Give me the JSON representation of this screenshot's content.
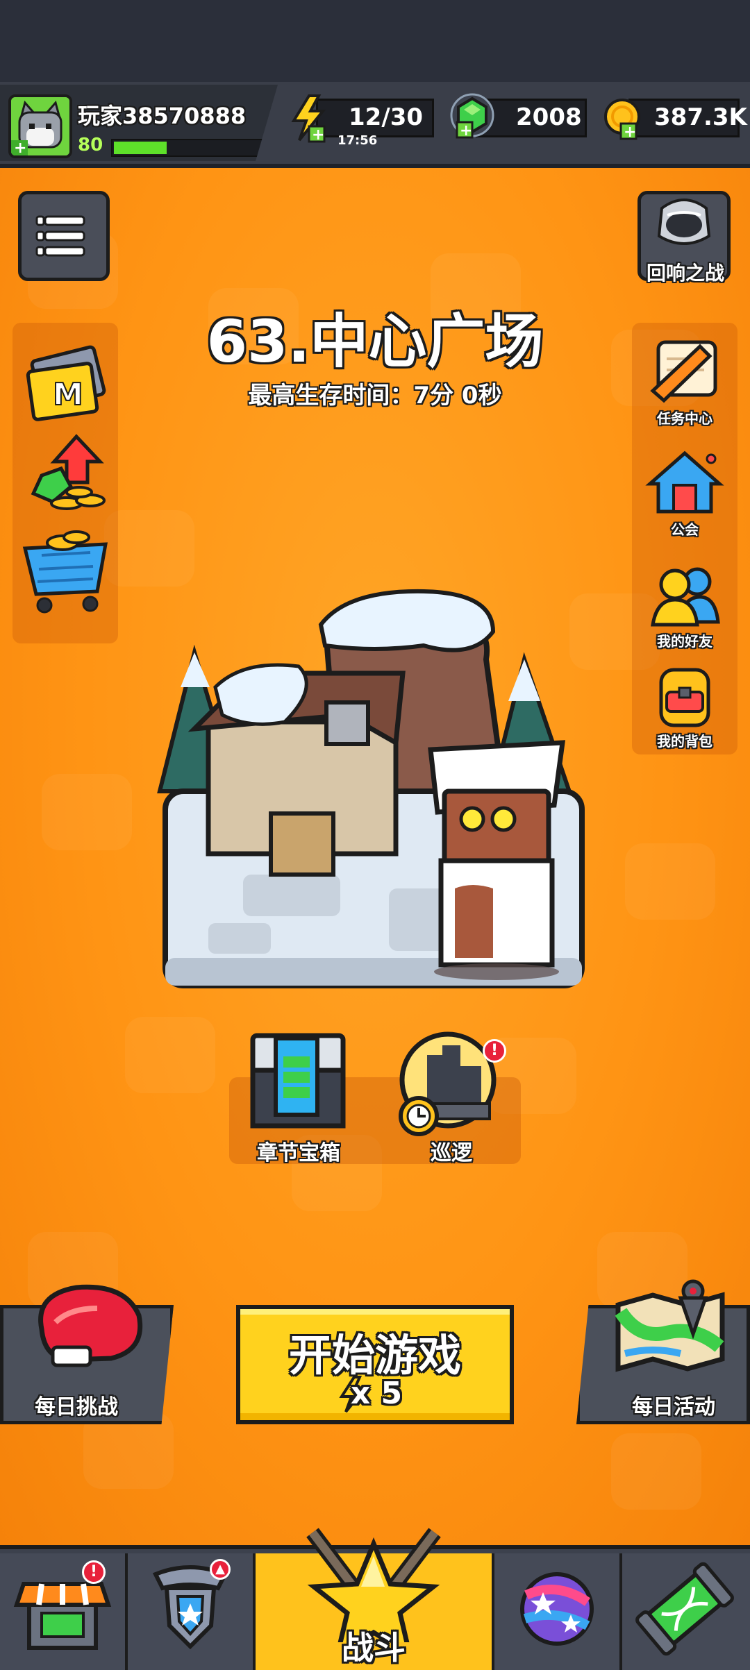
{
  "player": {
    "name": "玩家38570888",
    "level": "80",
    "xp_fraction": 0.35
  },
  "resources": {
    "energy": {
      "value": "12/30",
      "timer": "17:56",
      "icon": "lightning-icon"
    },
    "gems": {
      "value": "2008",
      "icon": "green-gem-icon"
    },
    "coins": {
      "value": "387.3K",
      "icon": "gold-coin-icon"
    }
  },
  "stage": {
    "title": "63.中心广场",
    "best_time": "最高生存时间：7分 0秒"
  },
  "right_menu": {
    "echo_battle": "回响之战",
    "tasks": "任务中心",
    "guild": "公会",
    "friends": "我的好友",
    "backpack": "我的背包"
  },
  "chapter_row": {
    "chest": "章节宝箱",
    "patrol": "巡逻"
  },
  "actions": {
    "daily_challenge": "每日挑战",
    "start": "开始游戏",
    "start_cost": "x 5",
    "daily_event": "每日活动"
  },
  "bottom_nav": {
    "battle": "战斗"
  },
  "colors": {
    "accent": "#ff9a1a",
    "start_button": "#ffd21e",
    "nav_active": "#ffc21c",
    "badge": "#e8213b"
  }
}
